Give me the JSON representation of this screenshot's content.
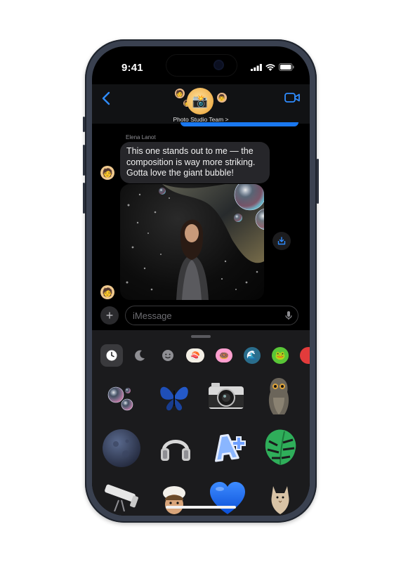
{
  "status_bar": {
    "time": "9:41"
  },
  "header": {
    "group_name": "Photo Studio Team >"
  },
  "message": {
    "sender": "Elena Lanot",
    "text": "This one stands out to me — the composition is way more striking. Gotta love the giant bubble!"
  },
  "composer": {
    "placeholder": "iMessage"
  },
  "sticker_drawer": {
    "categories": [
      "recents-icon",
      "moon-icon",
      "memoji-face-icon",
      "sushi-sticker",
      "pink-donut-sticker",
      "wave-sticker",
      "green-frog-sticker",
      "red-item-sticker"
    ],
    "stickers": [
      "bubbles",
      "butterfly",
      "camera",
      "owl",
      "moon",
      "headphones",
      "a-plus",
      "monstera-leaf",
      "telescope",
      "memoji",
      "blue-heart",
      "cat"
    ]
  },
  "colors": {
    "accent": "#2f8cff",
    "bubble_bg": "#26262a",
    "drawer_bg": "#1b1b1d"
  }
}
